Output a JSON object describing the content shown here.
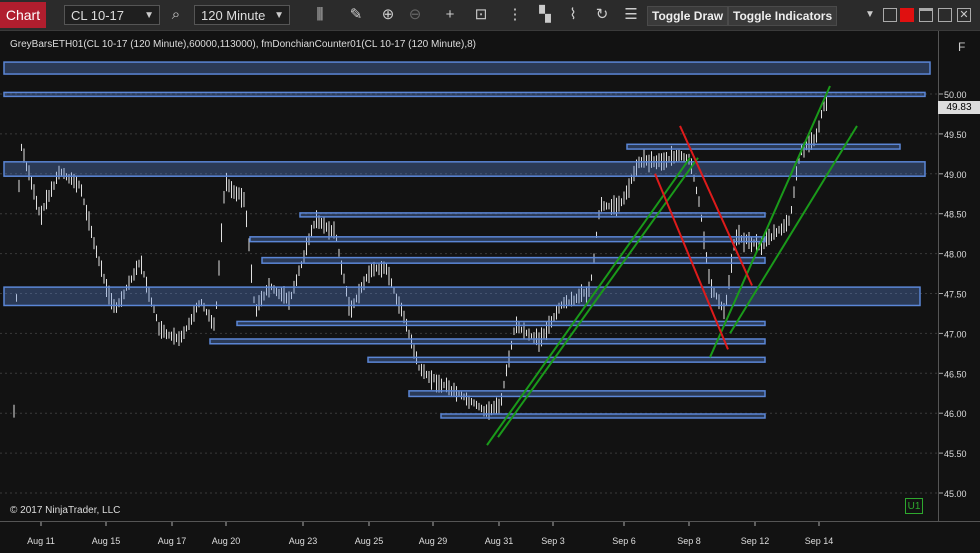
{
  "toolbar": {
    "chart_label": "Chart",
    "instrument": "CL 10-17",
    "interval": "120 Minute",
    "toggle_draw_label": "Toggle Draw",
    "toggle_indicators_label": "Toggle Indicators",
    "icons": [
      "search-icon",
      "bar-style-icon",
      "pencil-icon",
      "zoom-in-icon",
      "zoom-out-icon",
      "crosshair-icon",
      "data-box-icon",
      "indicators-icon",
      "strategies-icon",
      "drawing-tools-icon",
      "reload-icon",
      "properties-icon"
    ]
  },
  "chart": {
    "indicator_label": "GreyBarsETH01(CL 10-17 (120 Minute),60000,113000), fmDonchianCounter01(CL 10-17 (120 Minute),8)",
    "copyright": "© 2017 NinjaTrader, LLC",
    "panel_badge": "U1",
    "side_label": "F",
    "current_price": "49.83",
    "colors": {
      "background": "#121212",
      "zone": "#5b86d6",
      "up_trend": "#1a9a1a",
      "down_trend": "#dd1b1b",
      "bars": "#e0e0e0"
    }
  },
  "price_axis": {
    "labels": [
      "50.00",
      "49.50",
      "49.00",
      "48.50",
      "48.00",
      "47.50",
      "47.00",
      "46.50",
      "46.00",
      "45.50",
      "45.00"
    ]
  },
  "date_axis": {
    "labels": [
      "Aug 11",
      "Aug 15",
      "Aug 17",
      "Aug 20",
      "Aug 23",
      "Aug 25",
      "Aug 29",
      "Aug 31",
      "Sep 3",
      "Sep 6",
      "Sep 8",
      "Sep 12",
      "Sep 14"
    ]
  }
}
